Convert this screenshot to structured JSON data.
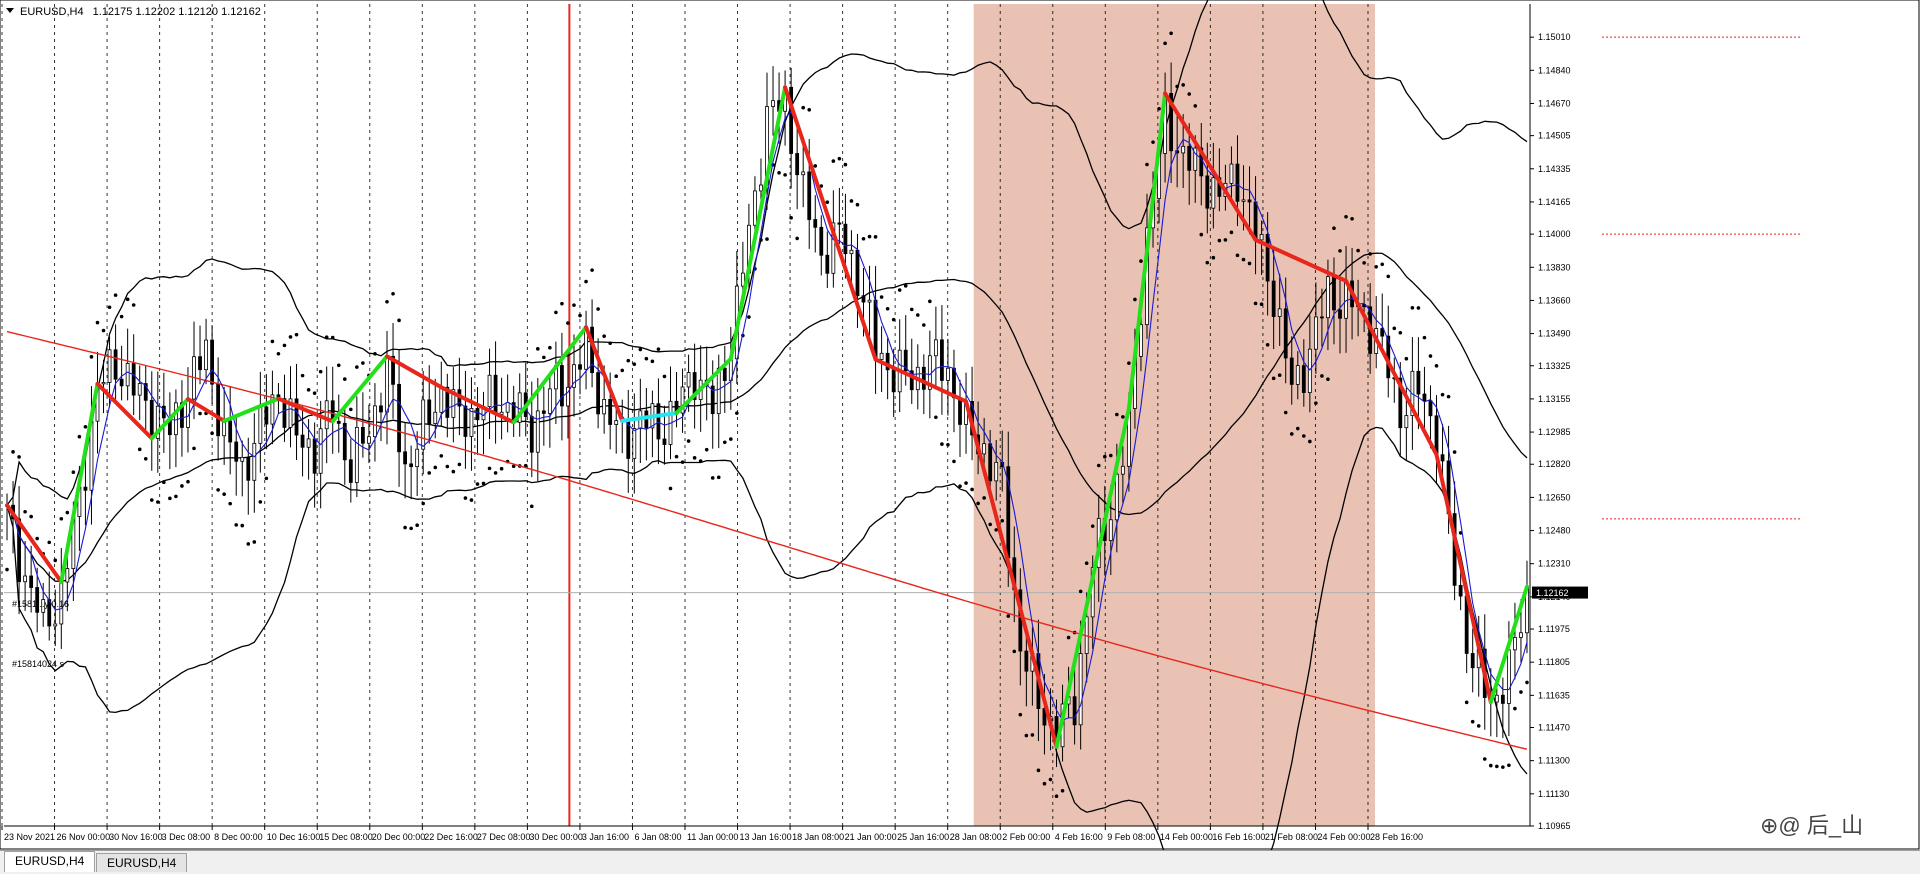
{
  "header": {
    "symbol_label": "EURUSD,H4",
    "ohlc": "1.12175 1.12202 1.12120 1.12162"
  },
  "tabs": [
    {
      "label": "EURUSD,H4",
      "active": true
    },
    {
      "label": "EURUSD,H4",
      "active": false
    }
  ],
  "watermark": "⊕@ 后_山",
  "order_labels": [
    "#1581...y 0.16",
    "#15814024 s"
  ],
  "colors": {
    "candle": "#000000",
    "ma_fast": "#1a1ad0",
    "ma_slow": "#e8261c",
    "band": "#000000",
    "zigzag_up": "#22e01a",
    "zigzag_down": "#e8261c",
    "zigzag_flat": "#22e6f0",
    "highlight_zone": "#e8bfb0",
    "vline": "#e8261c",
    "price_tag_bg": "#000000",
    "grid": "#000000"
  },
  "chart_data": {
    "type": "candlestick",
    "title": "EURUSD,H4",
    "ylim": [
      1.10965,
      1.1518
    ],
    "y_ticks": [
      1.1501,
      1.1484,
      1.1467,
      1.14505,
      1.14335,
      1.14165,
      1.14,
      1.1383,
      1.1366,
      1.1349,
      1.13325,
      1.13155,
      1.12985,
      1.1282,
      1.1265,
      1.1248,
      1.1231,
      1.1214,
      1.11975,
      1.11805,
      1.11635,
      1.1147,
      1.113,
      1.1113,
      1.10965
    ],
    "x_ticks": [
      "23 Nov 2021",
      "26 Nov 00:00",
      "30 Nov 16:00",
      "3 Dec 08:00",
      "8 Dec 00:00",
      "10 Dec 16:00",
      "15 Dec 08:00",
      "20 Dec 00:00",
      "22 Dec 16:00",
      "27 Dec 08:00",
      "30 Dec 00:00",
      "3 Jan 16:00",
      "6 Jan 08:00",
      "11 Jan 00:00",
      "13 Jan 16:00",
      "18 Jan 08:00",
      "21 Jan 00:00",
      "25 Jan 16:00",
      "28 Jan 08:00",
      "2 Feb 00:00",
      "4 Feb 16:00",
      "9 Feb 08:00",
      "14 Feb 00:00",
      "16 Feb 16:00",
      "21 Feb 08:00",
      "24 Feb 00:00",
      "28 Feb 16:00"
    ],
    "current_price": 1.12162,
    "price_markers": [
      1.1501,
      1.14,
      1.1254
    ],
    "highlight_zone": {
      "from": "28 Jan 08:00",
      "to": "28 Feb 16:00"
    },
    "vertical_marker": "30 Dec 00:00",
    "close_path": [
      [
        0,
        1.1255
      ],
      [
        3,
        1.1225
      ],
      [
        6,
        1.12
      ],
      [
        9,
        1.1215
      ],
      [
        12,
        1.1265
      ],
      [
        15,
        1.132
      ],
      [
        18,
        1.1335
      ],
      [
        21,
        1.132
      ],
      [
        24,
        1.131
      ],
      [
        27,
        1.1298
      ],
      [
        30,
        1.132
      ],
      [
        33,
        1.134
      ],
      [
        36,
        1.1295
      ],
      [
        39,
        1.128
      ],
      [
        42,
        1.13
      ],
      [
        45,
        1.132
      ],
      [
        48,
        1.1295
      ],
      [
        51,
        1.129
      ],
      [
        54,
        1.131
      ],
      [
        57,
        1.128
      ],
      [
        60,
        1.13
      ],
      [
        63,
        1.133
      ],
      [
        66,
        1.128
      ],
      [
        69,
        1.13
      ],
      [
        72,
        1.132
      ],
      [
        75,
        1.1305
      ],
      [
        78,
        1.131
      ],
      [
        81,
        1.1315
      ],
      [
        84,
        1.131
      ],
      [
        87,
        1.13
      ],
      [
        90,
        1.1318
      ],
      [
        93,
        1.1325
      ],
      [
        96,
        1.134
      ],
      [
        99,
        1.131
      ],
      [
        102,
        1.1295
      ],
      [
        105,
        1.1305
      ],
      [
        108,
        1.13
      ],
      [
        111,
        1.131
      ],
      [
        114,
        1.133
      ],
      [
        117,
        1.131
      ],
      [
        120,
        1.1345
      ],
      [
        123,
        1.14
      ],
      [
        126,
        1.146
      ],
      [
        129,
        1.1468
      ],
      [
        132,
        1.142
      ],
      [
        135,
        1.139
      ],
      [
        138,
        1.14
      ],
      [
        141,
        1.138
      ],
      [
        144,
        1.134
      ],
      [
        147,
        1.133
      ],
      [
        150,
        1.1325
      ],
      [
        153,
        1.1335
      ],
      [
        156,
        1.133
      ],
      [
        159,
        1.13
      ],
      [
        162,
        1.129
      ],
      [
        165,
        1.127
      ],
      [
        168,
        1.119
      ],
      [
        171,
        1.116
      ],
      [
        174,
        1.1145
      ],
      [
        177,
        1.116
      ],
      [
        180,
        1.123
      ],
      [
        183,
        1.126
      ],
      [
        186,
        1.13
      ],
      [
        189,
        1.14
      ],
      [
        192,
        1.146
      ],
      [
        195,
        1.144
      ],
      [
        198,
        1.143
      ],
      [
        201,
        1.142
      ],
      [
        204,
        1.143
      ],
      [
        207,
        1.14
      ],
      [
        210,
        1.137
      ],
      [
        213,
        1.132
      ],
      [
        216,
        1.134
      ],
      [
        219,
        1.137
      ],
      [
        222,
        1.1365
      ],
      [
        225,
        1.136
      ],
      [
        228,
        1.134
      ],
      [
        231,
        1.131
      ],
      [
        234,
        1.132
      ],
      [
        237,
        1.13
      ],
      [
        240,
        1.1225
      ],
      [
        243,
        1.118
      ],
      [
        246,
        1.116
      ],
      [
        249,
        1.1175
      ],
      [
        252,
        1.1216
      ]
    ],
    "series": [
      {
        "name": "zigzag",
        "type": "line"
      },
      {
        "name": "bollinger_upper",
        "type": "line"
      },
      {
        "name": "bollinger_middle",
        "type": "line"
      },
      {
        "name": "bollinger_lower",
        "type": "line"
      },
      {
        "name": "ma_long",
        "type": "line"
      },
      {
        "name": "ma_fast",
        "type": "line"
      },
      {
        "name": "parabolic_sar",
        "type": "scatter"
      }
    ],
    "grid": true,
    "legend": "none"
  }
}
